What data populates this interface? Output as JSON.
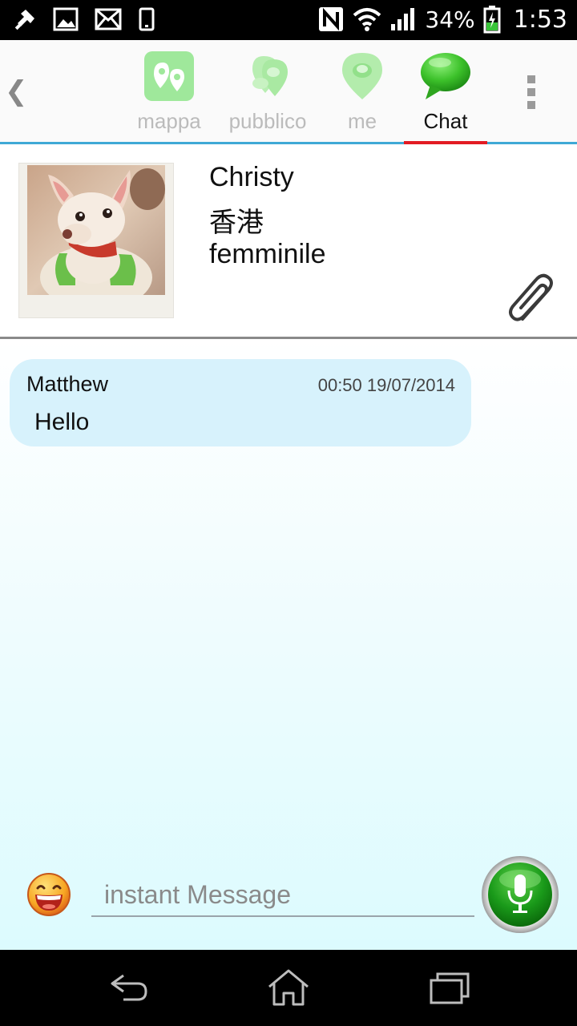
{
  "status_bar": {
    "battery": "34%",
    "time": "1:53",
    "icons": [
      "pin-icon",
      "image-icon",
      "mail-icon",
      "phone-icon",
      "nfc-icon",
      "wifi-icon",
      "signal-icon",
      "battery-charging-icon"
    ]
  },
  "tabs": [
    {
      "label": "mappa",
      "icon": "map-pin-icon",
      "active": false
    },
    {
      "label": "pubblico",
      "icon": "public-pins-icon",
      "active": false
    },
    {
      "label": "me",
      "icon": "me-pin-icon",
      "active": false
    },
    {
      "label": "Chat",
      "icon": "chat-bubble-icon",
      "active": true
    }
  ],
  "profile": {
    "name": "Christy",
    "city": "香港",
    "gender": "femminile"
  },
  "messages": [
    {
      "sender": "Matthew",
      "timestamp": "00:50 19/07/2014",
      "text": "Hello"
    }
  ],
  "composer": {
    "placeholder": "instant Message"
  },
  "colors": {
    "accent_blue": "#3fa9d6",
    "active_tab_underline": "#e21b23",
    "bubble": "#d7f2fc",
    "mic_green": "#1a9a1a"
  }
}
